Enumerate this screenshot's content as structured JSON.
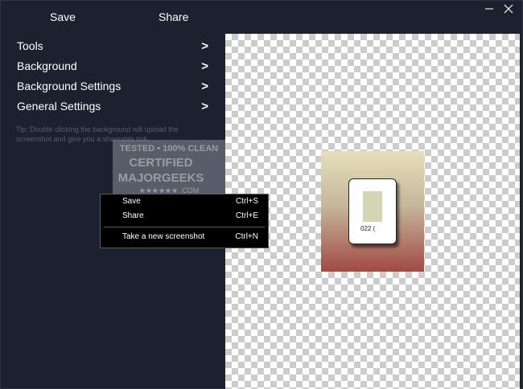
{
  "topbar": {
    "save_label": "Save",
    "share_label": "Share"
  },
  "window_controls": {
    "minimize_icon": "minimize-icon",
    "close_icon": "close-icon"
  },
  "sidebar": {
    "items": [
      {
        "label": "Tools",
        "chevron": ">"
      },
      {
        "label": "Background",
        "chevron": ">"
      },
      {
        "label": "Background Settings",
        "chevron": ">"
      },
      {
        "label": "General Settings",
        "chevron": ">"
      }
    ],
    "tip": "Tip: Double clicking the background will upload the screenshot and give you a shareable link."
  },
  "preview": {
    "card_text": "022 (",
    "gradient_colors": [
      "#e6dfbb",
      "#c5b79a",
      "#a14a44"
    ]
  },
  "watermark": {
    "line1": "TESTED • 100% CLEAN",
    "line2": "CERTIFIED",
    "line3": "MAJORGEEKS",
    "line4": "★★★★★★ .COM"
  },
  "context_menu": {
    "items": [
      {
        "label": "Save",
        "shortcut": "Ctrl+S"
      },
      {
        "label": "Share",
        "shortcut": "Ctrl+E"
      },
      {
        "label": "Take a new screenshot",
        "shortcut": "Ctrl+N"
      }
    ]
  },
  "colors": {
    "app_background": "#1c2130",
    "tip_text": "#565d6f",
    "menu_background": "#000000",
    "menu_border": "#5b5b5b"
  }
}
